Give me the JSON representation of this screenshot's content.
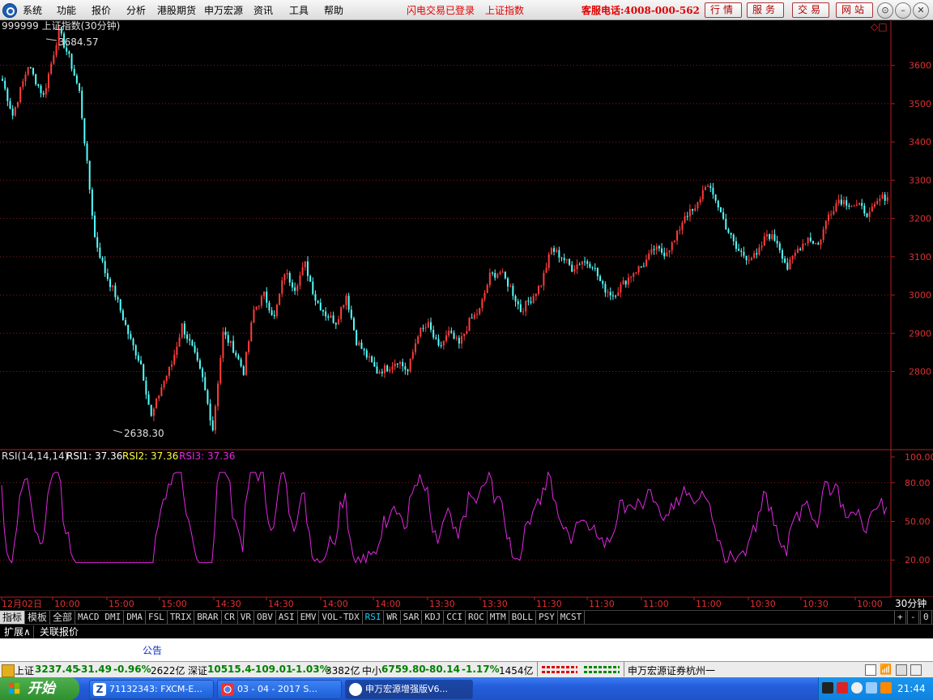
{
  "menu": {
    "items": [
      "系统",
      "功能",
      "报价",
      "分析",
      "港股期货",
      "申万宏源",
      "资讯",
      "工具",
      "帮助"
    ],
    "status1": "闪电交易已登录",
    "status2": "上证指数",
    "hotline": "客服电话:4008-000-562",
    "buttons": [
      "行情",
      "服务",
      "交易",
      "网站"
    ]
  },
  "chart": {
    "title": "999999 上证指数(30分钟)",
    "high_label": "3684.57",
    "low_label": "2638.30",
    "price_ticks": [
      "3600",
      "3500",
      "3400",
      "3300",
      "3200",
      "3100",
      "3000",
      "2900",
      "2800"
    ],
    "rsi_label": "RSI(14,14,14)",
    "rsi1": "RSI1: 37.36",
    "rsi2": "RSI2: 37.36",
    "rsi3": "RSI3: 37.36",
    "rsi_ticks": [
      "100.00",
      "80.00",
      "50.00",
      "20.00"
    ],
    "time_labels": [
      "12月02日",
      "10:00",
      "15:00",
      "15:00",
      "14:30",
      "14:30",
      "14:00",
      "14:00",
      "13:30",
      "13:30",
      "11:30",
      "11:30",
      "11:00",
      "11:00",
      "10:30",
      "10:30",
      "10:00"
    ],
    "period": "30分钟",
    "colors": {
      "up": "#ff3c3c",
      "down": "#54ffff",
      "rsi": "#e028e0",
      "axis": "#b02020",
      "grid": "#8a1a1a"
    }
  },
  "chart_data": [
    {
      "type": "candlestick",
      "title": "999999 上证指数(30分钟)",
      "ylim": [
        2600,
        3720
      ],
      "yticks": [
        2800,
        2900,
        3000,
        3100,
        3200,
        3300,
        3400,
        3500,
        3600
      ],
      "x_labels": [
        "12月02日",
        "10:00",
        "15:00",
        "15:00",
        "14:30",
        "14:30",
        "14:00",
        "14:00",
        "13:30",
        "13:30",
        "11:30",
        "11:30",
        "11:00",
        "11:00",
        "10:30",
        "10:30",
        "10:00"
      ],
      "annotations": [
        {
          "label": "3684.57",
          "value": 3684.57
        },
        {
          "label": "2638.30",
          "value": 2638.3
        }
      ],
      "anchors": [
        [
          0,
          3560
        ],
        [
          4,
          3470
        ],
        [
          10,
          3600
        ],
        [
          16,
          3520
        ],
        [
          22,
          3690
        ],
        [
          26,
          3620
        ],
        [
          30,
          3530
        ],
        [
          36,
          3150
        ],
        [
          40,
          3060
        ],
        [
          44,
          3000
        ],
        [
          50,
          2880
        ],
        [
          54,
          2820
        ],
        [
          58,
          2680
        ],
        [
          62,
          2760
        ],
        [
          66,
          2820
        ],
        [
          70,
          2920
        ],
        [
          74,
          2860
        ],
        [
          78,
          2780
        ],
        [
          82,
          2650
        ],
        [
          86,
          2900
        ],
        [
          90,
          2860
        ],
        [
          94,
          2800
        ],
        [
          98,
          2960
        ],
        [
          102,
          3000
        ],
        [
          106,
          2940
        ],
        [
          110,
          3060
        ],
        [
          114,
          3020
        ],
        [
          118,
          3080
        ],
        [
          122,
          2990
        ],
        [
          126,
          2950
        ],
        [
          130,
          2930
        ],
        [
          134,
          3000
        ],
        [
          138,
          2880
        ],
        [
          142,
          2840
        ],
        [
          146,
          2800
        ],
        [
          150,
          2810
        ],
        [
          154,
          2830
        ],
        [
          158,
          2800
        ],
        [
          162,
          2900
        ],
        [
          166,
          2920
        ],
        [
          170,
          2860
        ],
        [
          174,
          2900
        ],
        [
          178,
          2870
        ],
        [
          182,
          2930
        ],
        [
          186,
          2960
        ],
        [
          190,
          3050
        ],
        [
          194,
          3060
        ],
        [
          198,
          3020
        ],
        [
          202,
          2960
        ],
        [
          206,
          2990
        ],
        [
          210,
          3030
        ],
        [
          214,
          3120
        ],
        [
          218,
          3100
        ],
        [
          222,
          3070
        ],
        [
          226,
          3090
        ],
        [
          230,
          3080
        ],
        [
          234,
          3020
        ],
        [
          238,
          3000
        ],
        [
          242,
          3030
        ],
        [
          246,
          3060
        ],
        [
          250,
          3080
        ],
        [
          254,
          3120
        ],
        [
          258,
          3110
        ],
        [
          262,
          3140
        ],
        [
          266,
          3210
        ],
        [
          270,
          3220
        ],
        [
          274,
          3290
        ],
        [
          278,
          3250
        ],
        [
          282,
          3180
        ],
        [
          286,
          3120
        ],
        [
          290,
          3100
        ],
        [
          294,
          3100
        ],
        [
          298,
          3160
        ],
        [
          302,
          3140
        ],
        [
          306,
          3070
        ],
        [
          310,
          3120
        ],
        [
          314,
          3150
        ],
        [
          318,
          3130
        ],
        [
          322,
          3210
        ],
        [
          326,
          3250
        ],
        [
          330,
          3240
        ],
        [
          334,
          3230
        ],
        [
          338,
          3210
        ],
        [
          342,
          3250
        ],
        [
          345,
          3260
        ]
      ]
    },
    {
      "type": "line",
      "title": "RSI(14,14,14)",
      "ylim": [
        0,
        100
      ],
      "yticks": [
        20,
        50,
        80,
        100
      ],
      "series": [
        {
          "name": "RSI1",
          "last": 37.36
        },
        {
          "name": "RSI2",
          "last": 37.36
        },
        {
          "name": "RSI3",
          "last": 37.36
        }
      ]
    }
  ],
  "tabs": {
    "first": "指标",
    "items": [
      "模板",
      "全部",
      "MACD",
      "DMI",
      "DMA",
      "FSL",
      "TRIX",
      "BRAR",
      "CR",
      "VR",
      "OBV",
      "ASI",
      "EMV",
      "VOL-TDX",
      "RSI",
      "WR",
      "SAR",
      "KDJ",
      "CCI",
      "ROC",
      "MTM",
      "BOLL",
      "PSY",
      "MCST"
    ],
    "active": "RSI",
    "controls": [
      "+",
      "-",
      "0"
    ]
  },
  "tabs2": [
    "扩展∧",
    "关联报价"
  ],
  "bulletin": "公告",
  "ticker": {
    "sh_name": "上证",
    "sh_val": "3237.45",
    "sh_chg": "-31.49",
    "sh_pct": "-0.96%",
    "sh_amt": "2622亿",
    "sz_name": "深证",
    "sz_val": "10515.4",
    "sz_chg": "-109.01",
    "sz_pct": "-1.03%",
    "sz_amt": "3382亿",
    "zx_name": "中小",
    "zx_val": "6759.80",
    "zx_chg": "-80.14",
    "zx_pct": "-1.17%",
    "zx_amt": "1454亿",
    "broker": "申万宏源证券杭州一"
  },
  "taskbar": {
    "start": "开始",
    "items": [
      "71132343: FXCM-E...",
      "03 - 04 - 2017 S...",
      "申万宏源增强版V6..."
    ],
    "clock": "21:44"
  }
}
